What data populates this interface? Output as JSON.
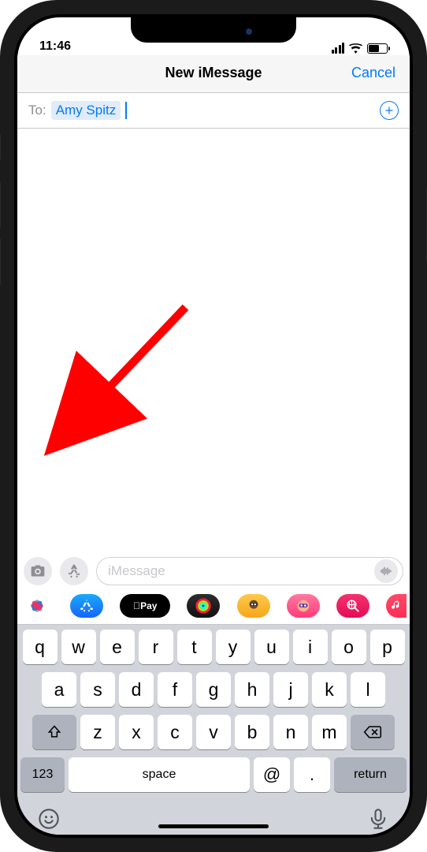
{
  "status": {
    "time": "11:46"
  },
  "nav": {
    "title": "New iMessage",
    "cancel": "Cancel"
  },
  "to": {
    "label": "To:",
    "recipient": "Amy Spitz"
  },
  "compose": {
    "placeholder": "iMessage"
  },
  "app_strip": {
    "apple_pay_label": "Pay"
  },
  "keyboard": {
    "rows": [
      [
        "q",
        "w",
        "e",
        "r",
        "t",
        "y",
        "u",
        "i",
        "o",
        "p"
      ],
      [
        "a",
        "s",
        "d",
        "f",
        "g",
        "h",
        "j",
        "k",
        "l"
      ],
      [
        "z",
        "x",
        "c",
        "v",
        "b",
        "n",
        "m"
      ]
    ],
    "numbers_key": "123",
    "space_key": "space",
    "at_key": "@",
    "dot_key": ".",
    "return_key": "return"
  }
}
